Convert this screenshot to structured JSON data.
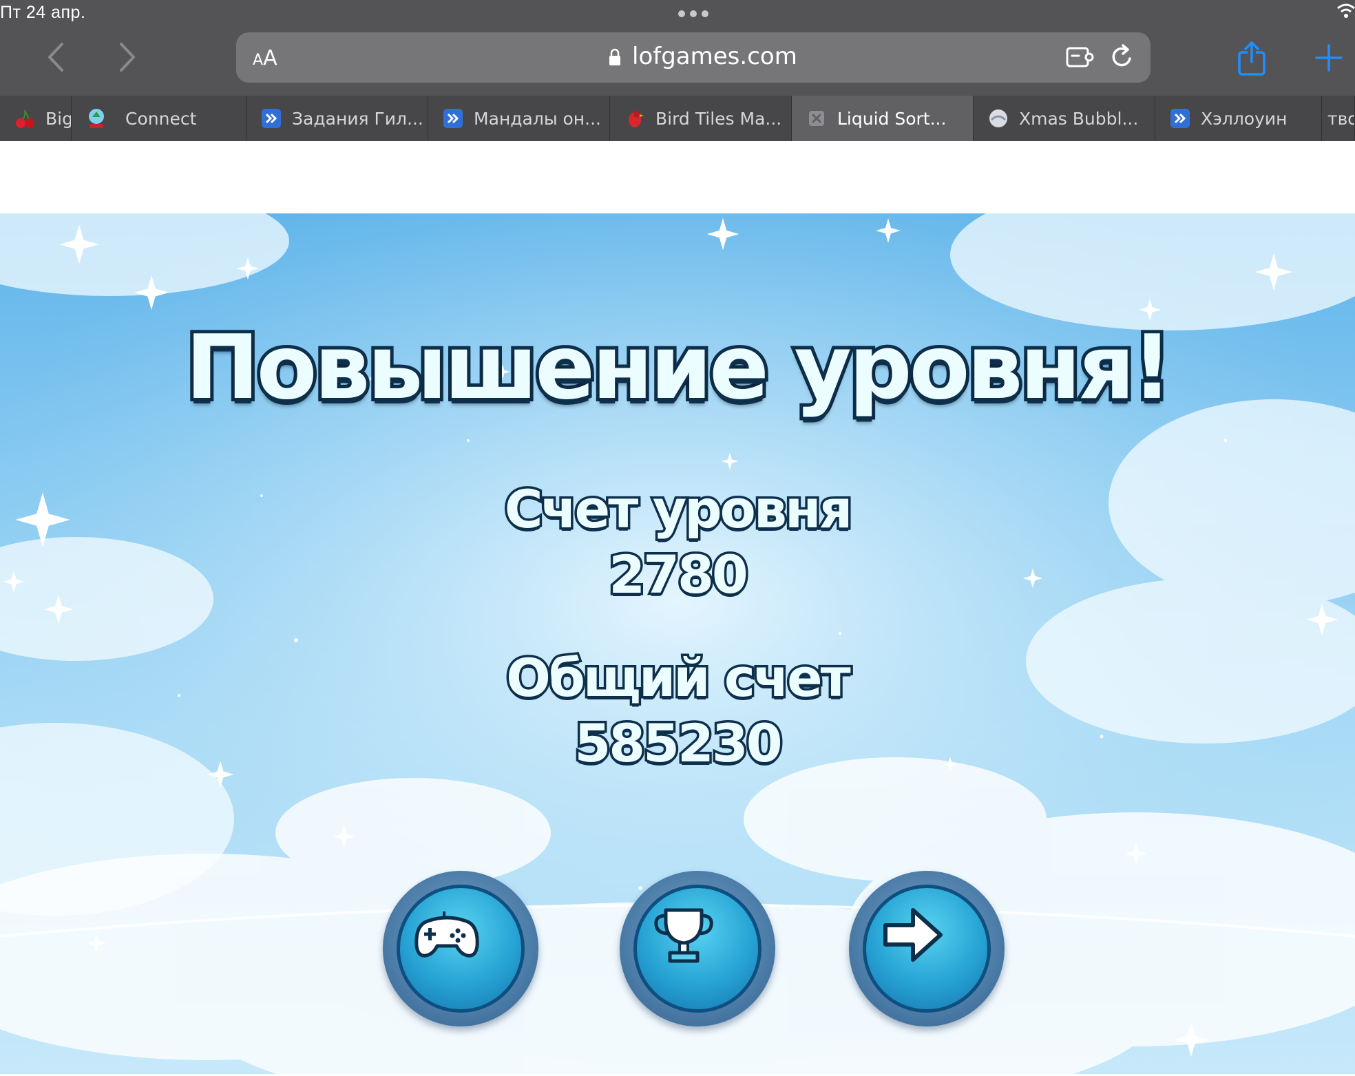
{
  "status_bar": {
    "time": "Пт 24 апр."
  },
  "browser": {
    "reader_small": "A",
    "reader_big": "A",
    "url": "lofgames.com"
  },
  "tabs": [
    {
      "label": "Big",
      "icon": "cherry-icon",
      "active": false
    },
    {
      "label": "Connect",
      "icon": "snowglobe-icon",
      "active": false
    },
    {
      "label": "Задания Гил...",
      "icon": "game-tile-icon",
      "active": false
    },
    {
      "label": "Мандалы он...",
      "icon": "game-tile-icon",
      "active": false
    },
    {
      "label": "Bird Tiles Ma...",
      "icon": "bird-icon",
      "active": false
    },
    {
      "label": "Liquid Sort...",
      "icon": "close-icon",
      "active": true
    },
    {
      "label": "Xmas Bubbl...",
      "icon": "bubble-icon",
      "active": false
    },
    {
      "label": "Хэллоуин",
      "icon": "game-tile-icon",
      "active": false
    },
    {
      "label": "тво",
      "icon": "",
      "active": false
    }
  ],
  "game": {
    "title": "Повышение уровня!",
    "level_score_label": "Счет уровня",
    "level_score_value": "2780",
    "total_score_label": "Общий счет",
    "total_score_value": "585230",
    "buttons": [
      {
        "name": "play-more-button",
        "icon": "gamepad-icon"
      },
      {
        "name": "leaderboard-button",
        "icon": "trophy-icon"
      },
      {
        "name": "next-level-button",
        "icon": "arrow-right-icon"
      }
    ]
  }
}
